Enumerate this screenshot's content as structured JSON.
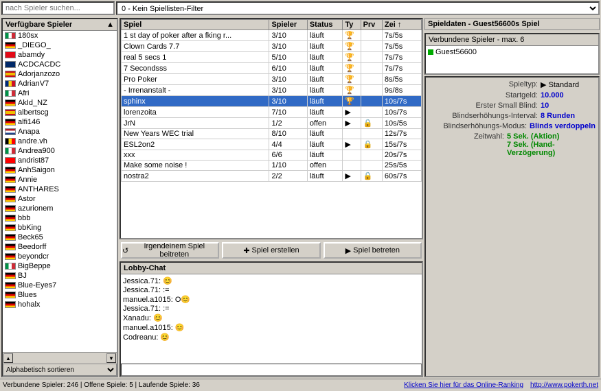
{
  "topBar": {
    "searchPlaceholder": "nach Spieler suchen...",
    "filterOptions": [
      "0 - Kein Spiellisten-Filter"
    ]
  },
  "leftPanel": {
    "header": "Verfügbare Spieler",
    "players": [
      {
        "name": "180sx",
        "flag": "it"
      },
      {
        "name": "_DIEGO_",
        "flag": "de"
      },
      {
        "name": "abamdy",
        "flag": "tr"
      },
      {
        "name": "ACDCACDC",
        "flag": "us"
      },
      {
        "name": "Adorjanzozo",
        "flag": "es"
      },
      {
        "name": "AdrianV7",
        "flag": "ro"
      },
      {
        "name": "Afri",
        "flag": "it"
      },
      {
        "name": "AkId_NZ",
        "flag": "de"
      },
      {
        "name": "albertscg",
        "flag": "es"
      },
      {
        "name": "alfi146",
        "flag": "de"
      },
      {
        "name": "Anapa",
        "flag": "nl"
      },
      {
        "name": "andre.vh",
        "flag": "be"
      },
      {
        "name": "Andrea900",
        "flag": "it"
      },
      {
        "name": "andrist87",
        "flag": "ch"
      },
      {
        "name": "AnhSaigon",
        "flag": "de"
      },
      {
        "name": "Annie",
        "flag": "de"
      },
      {
        "name": "ANTHARES",
        "flag": "de"
      },
      {
        "name": "Astor",
        "flag": "de"
      },
      {
        "name": "azurionem",
        "flag": "de"
      },
      {
        "name": "bbb",
        "flag": "de"
      },
      {
        "name": "bbKing",
        "flag": "de"
      },
      {
        "name": "Beck65",
        "flag": "de"
      },
      {
        "name": "Beedorff",
        "flag": "de"
      },
      {
        "name": "beyondcr",
        "flag": "de"
      },
      {
        "name": "BigBeppe",
        "flag": "it"
      },
      {
        "name": "BJ",
        "flag": "de"
      },
      {
        "name": "Blue-Eyes7",
        "flag": "de"
      },
      {
        "name": "Blues",
        "flag": "de"
      },
      {
        "name": "hohalx",
        "flag": "de"
      }
    ],
    "sortLabel": "Alphabetisch sortieren"
  },
  "gameTable": {
    "columns": [
      "Spiel",
      "Spieler",
      "Status",
      "Ty",
      "Prv",
      "Zei ↑"
    ],
    "rows": [
      {
        "spiel": "1 st day of poker after a fking r...",
        "spieler": "3/10",
        "status": "läuft",
        "typ": "trophy",
        "prv": "",
        "zeit": "7s/5s"
      },
      {
        "spiel": "Clown Cards 7.7",
        "spieler": "3/10",
        "status": "läuft",
        "typ": "trophy",
        "prv": "",
        "zeit": "7s/5s"
      },
      {
        "spiel": "real 5 secs 1",
        "spieler": "5/10",
        "status": "läuft",
        "typ": "trophy",
        "prv": "",
        "zeit": "7s/7s"
      },
      {
        "spiel": "7 Secondsss",
        "spieler": "6/10",
        "status": "läuft",
        "typ": "trophy",
        "prv": "",
        "zeit": "7s/7s"
      },
      {
        "spiel": "Pro Poker",
        "spieler": "3/10",
        "status": "läuft",
        "typ": "trophy",
        "prv": "",
        "zeit": "8s/5s"
      },
      {
        "spiel": "- Irrenanstalt -",
        "spieler": "3/10",
        "status": "läuft",
        "typ": "trophy",
        "prv": "",
        "zeit": "9s/8s"
      },
      {
        "spiel": "sphinx",
        "spieler": "3/10",
        "status": "läuft",
        "typ": "trophy",
        "prv": "",
        "zeit": "10s/7s"
      },
      {
        "spiel": "lorenzoita",
        "spieler": "7/10",
        "status": "läuft",
        "typ": "play",
        "prv": "",
        "zeit": "10s/7s"
      },
      {
        "spiel": "JrN",
        "spieler": "1/2",
        "status": "offen",
        "typ": "play",
        "prv": "lock",
        "zeit": "10s/5s"
      },
      {
        "spiel": "New Years WEC trial",
        "spieler": "8/10",
        "status": "läuft",
        "typ": "",
        "prv": "",
        "zeit": "12s/7s"
      },
      {
        "spiel": "ESL2on2",
        "spieler": "4/4",
        "status": "läuft",
        "typ": "play",
        "prv": "lock",
        "zeit": "15s/7s"
      },
      {
        "spiel": "xxx",
        "spieler": "6/6",
        "status": "läuft",
        "typ": "",
        "prv": "",
        "zeit": "20s/7s"
      },
      {
        "spiel": "Make some noise !",
        "spieler": "1/10",
        "status": "offen",
        "typ": "",
        "prv": "",
        "zeit": "25s/5s"
      },
      {
        "spiel": "nostra2",
        "spieler": "2/2",
        "status": "läuft",
        "typ": "play",
        "prv": "lock",
        "zeit": "60s/7s"
      }
    ]
  },
  "actionButtons": {
    "join": "Irgendeinem Spiel beitreten",
    "create": "Spiel erstellen",
    "observe": "Spiel betreten"
  },
  "chatPanel": {
    "header": "Lobby-Chat",
    "messages": [
      {
        "user": "Jessica.71",
        "text": "😊"
      },
      {
        "user": "Jessica.71",
        "text": ":="
      },
      {
        "user": "",
        "text": ""
      },
      {
        "user": "manuel.a1015",
        "text": "O😊"
      },
      {
        "user": "Jessica.71",
        "text": ":="
      },
      {
        "user": "",
        "text": ""
      },
      {
        "user": "Xanadu",
        "text": "😊"
      },
      {
        "user": "",
        "text": ""
      },
      {
        "user": "manuel.a1015",
        "text": "😊"
      },
      {
        "user": "",
        "text": ""
      },
      {
        "user": "Codreanu",
        "text": "😊"
      }
    ],
    "inputPlaceholder": ""
  },
  "rightPanel": {
    "header": "Spieldaten - Guest56600s Spiel",
    "connectedHeader": "Verbundene Spieler - max. 6",
    "connectedPlayers": [
      {
        "name": "Guest56600"
      }
    ],
    "gameInfo": {
      "spieltyp": "Standard",
      "startgeld": "10.000",
      "ersterSmallBlind": "10",
      "blindserhoehung": "8 Runden",
      "blindserhoehungModus": "Blinds verdoppeln",
      "zeitwahl": "5 Sek. (Aktion)\n7 Sek. (Hand-Verzögerung)"
    }
  },
  "statusBar": {
    "left": "Verbundene Spieler: 246 | Offene Spiele: 5 | Laufende Spiele: 36",
    "rankingLink": "Klicken Sie hier für das Online-Ranking",
    "websiteLink": "http://www.pokerth.net"
  }
}
